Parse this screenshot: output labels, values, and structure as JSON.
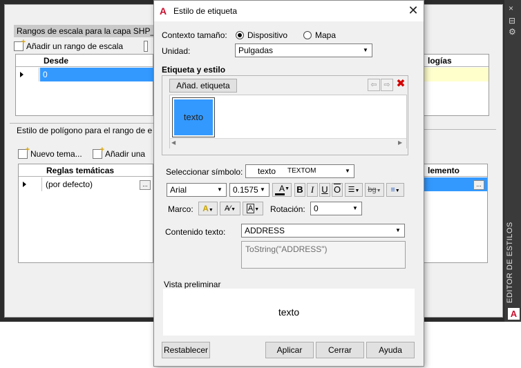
{
  "background_panel": {
    "section1_title": "Rangos de escala para la capa SHP_S",
    "add_scale_range_label": "Añadir un rango de escala",
    "grid1": {
      "col_from": "Desde",
      "col_right": "logías",
      "row_value": "0"
    },
    "section2_title": "Estilo de polígono para el rango de e",
    "new_theme_label": "Nuevo tema...",
    "add_label": "Añadir una",
    "grid2": {
      "col_rules": "Reglas temáticas",
      "col_right": "lemento",
      "row_value": "(por defecto)",
      "ellipsis": "..."
    },
    "rail_title": "EDITOR DE ESTILOS",
    "rail_buttons": [
      "×",
      "⊟",
      "⚙"
    ]
  },
  "dialog": {
    "title": "Estilo de etiqueta",
    "close_glyph": "✕",
    "size_context_label": "Contexto tamaño:",
    "radio_device": "Dispositivo",
    "radio_map": "Mapa",
    "size_context_selected": "Dispositivo",
    "unit_label": "Unidad:",
    "unit_value": "Pulgadas",
    "label_style_heading": "Etiqueta y estilo",
    "add_label_button": "Añad. etiqueta",
    "swatch_text": "texto",
    "select_symbol_label": "Seleccionar símbolo:",
    "symbol_text": "texto",
    "symbol_name": "TEXTOM",
    "font_value": "Arial",
    "size_value": "0.1575",
    "frame_label": "Marco:",
    "rotation_label": "Rotación:",
    "rotation_value": "0",
    "text_content_label": "Contenido texto:",
    "text_content_value": "ADDRESS",
    "expression": "ToString(\"ADDRESS\")",
    "preview_label": "Vista preliminar",
    "preview_text": "texto",
    "buttons": {
      "reset": "Restablecer",
      "apply": "Aplicar",
      "close": "Cerrar",
      "help": "Ayuda"
    },
    "format_buttons": {
      "bold": "B",
      "italic": "I",
      "underline": "U",
      "overline": "O",
      "strike": "bg"
    }
  },
  "colors": {
    "selection_blue": "#3399ff",
    "autodesk_red": "#c8102e"
  }
}
